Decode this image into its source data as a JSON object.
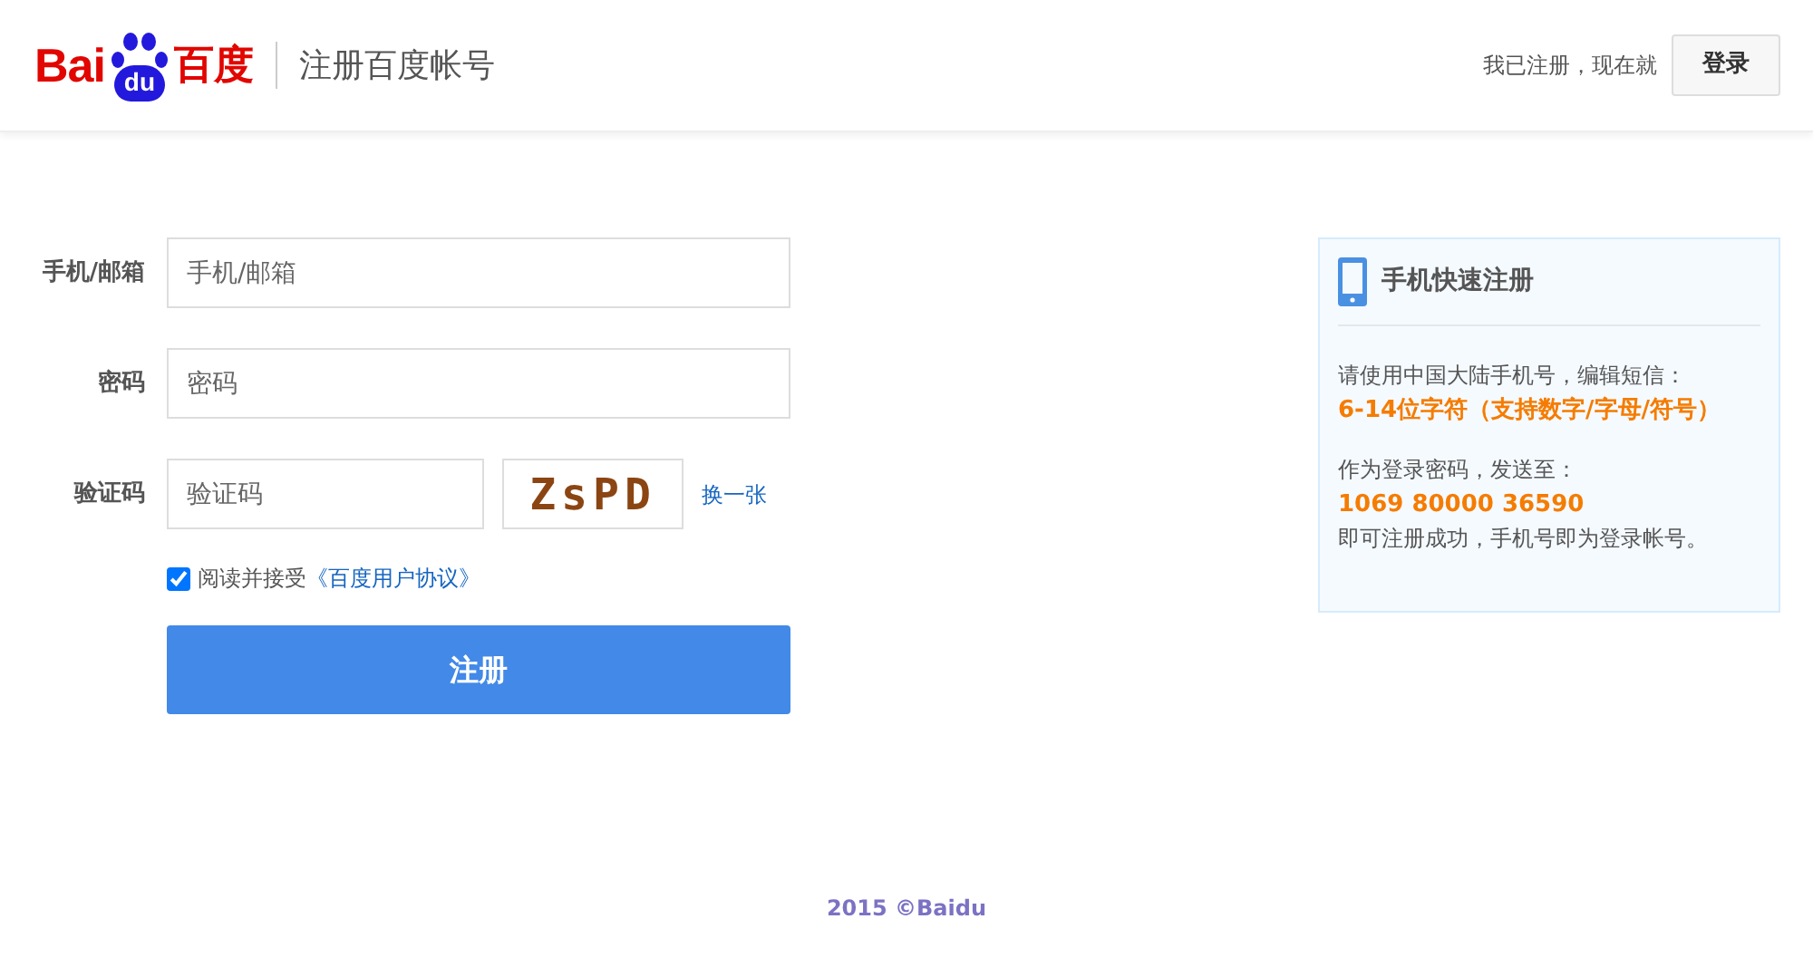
{
  "header": {
    "logo": {
      "latin": "Bai",
      "paw": "du",
      "chinese": "百度"
    },
    "title": "注册百度帐号",
    "login_prompt": "我已注册，现在就",
    "login_button": "登录"
  },
  "form": {
    "fields": [
      {
        "kind": "text",
        "label": "手机/邮箱",
        "placeholder": "手机/邮箱"
      },
      {
        "kind": "password",
        "label": "密码",
        "placeholder": "密码"
      },
      {
        "kind": "captcha",
        "label": "验证码",
        "placeholder": "验证码",
        "captcha": "ZsPD",
        "refresh": "换一张"
      }
    ],
    "agreement": {
      "checked": true,
      "text": "阅读并接受",
      "link": "《百度用户协议》"
    },
    "submit": "注册"
  },
  "sidebar": {
    "title": "手机快速注册",
    "paragraphs": [
      {
        "lines": [
          {
            "kind": "plain",
            "text": "请使用中国大陆手机号，编辑短信："
          },
          {
            "kind": "highlight",
            "text": "6-14位字符（支持数字/字母/符号）"
          }
        ]
      },
      {
        "lines": [
          {
            "kind": "plain",
            "text": "作为登录密码，发送至："
          },
          {
            "kind": "highlight",
            "text": "1069 80000 36590"
          },
          {
            "kind": "plain",
            "text": "即可注册成功，手机号即为登录帐号。"
          }
        ]
      }
    ]
  },
  "footer": "2015 ©Baidu"
}
